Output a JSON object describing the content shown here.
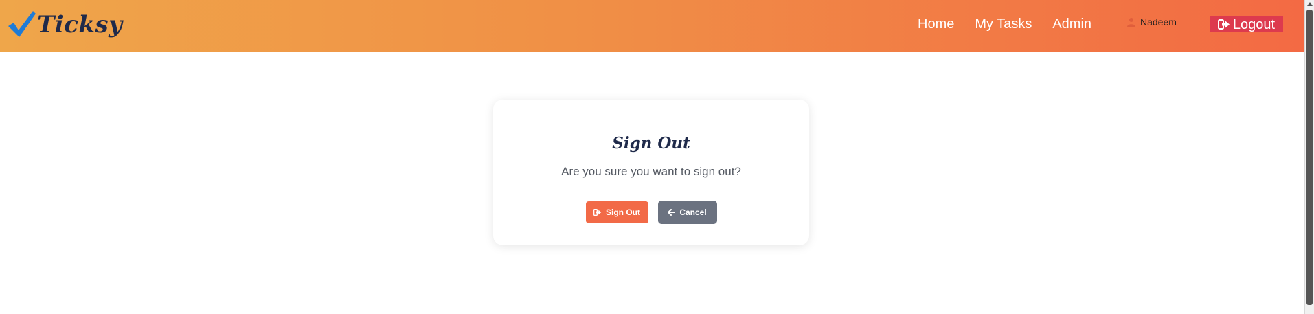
{
  "brand": {
    "name": "Ticksy",
    "check_color": "#1e7bd6"
  },
  "nav": {
    "links": [
      {
        "label": "Home",
        "icon": ""
      },
      {
        "label": "My Tasks",
        "icon": ""
      },
      {
        "label": "Admin",
        "icon": ""
      }
    ],
    "user_name": "Nadeem",
    "user_icon": "user-icon",
    "logout_label": "Logout",
    "logout_icon": "sign-out-icon"
  },
  "dialog": {
    "title": "Sign Out",
    "message": "Are you sure you want to sign out?",
    "confirm_label": "Sign Out",
    "confirm_icon": "sign-out-icon",
    "cancel_label": "Cancel",
    "cancel_icon": "arrow-left-icon"
  },
  "colors": {
    "header_gradient_start": "#efa64a",
    "header_gradient_end": "#f36a44",
    "logout_bg": "#dd3a4e",
    "signout_bg": "#f26a47",
    "cancel_bg": "#6b7280",
    "title_color": "#1f2a4a"
  }
}
